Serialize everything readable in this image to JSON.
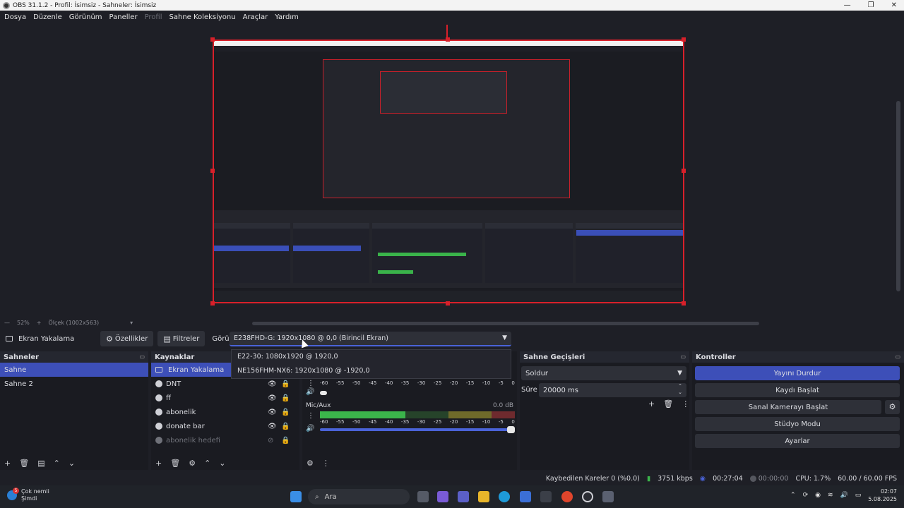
{
  "window": {
    "title": "OBS 31.1.2 - Profil: İsimsiz - Sahneler: İsimsiz"
  },
  "menu": [
    "Dosya",
    "Düzenle",
    "Görünüm",
    "Paneller",
    "Profil",
    "Sahne Koleksiyonu",
    "Araçlar",
    "Yardım"
  ],
  "preview_status": {
    "zoom": "52%",
    "scale": "Ölçek (1002x563)"
  },
  "source_toolbar": {
    "source_name": "Ekran Yakalama",
    "properties": "Özellikler",
    "filters": "Filtreler",
    "display_label": "Görüntü",
    "display_value": "E238FHD-G: 1920x1080 @ 0,0 (Birincil Ekran)",
    "display_options": [
      "E22-30: 1080x1920 @ 1920,0",
      "NE156FHM-NX6: 1920x1080 @ -1920,0"
    ]
  },
  "scenes": {
    "title": "Sahneler",
    "items": [
      "Sahne",
      "Sahne 2"
    ]
  },
  "sources": {
    "title": "Kaynaklar",
    "items": [
      "Ekran Yakalama",
      "DNT",
      "ff",
      "abonelik",
      "donate bar",
      "abonelik hedefi"
    ]
  },
  "mixer": {
    "ticks": [
      "-60",
      "-55",
      "-50",
      "-45",
      "-40",
      "-35",
      "-30",
      "-25",
      "-20",
      "-15",
      "-10",
      "-5",
      "0"
    ],
    "channels": [
      {
        "name": "Mic/Aux",
        "db": "0.0 dB",
        "level": 0.44
      }
    ]
  },
  "transitions": {
    "title": "Sahne Geçişleri",
    "type": "Soldur",
    "duration_label": "Süre",
    "duration": "20000 ms"
  },
  "controls": {
    "title": "Kontroller",
    "buttons": [
      "Yayını Durdur",
      "Kaydı Başlat",
      "Sanal Kamerayı Başlat",
      "Stüdyo Modu",
      "Ayarlar"
    ]
  },
  "status": {
    "dropped": "Kaybedilen Kareler 0 (%0.0)",
    "bitrate": "3751 kbps",
    "stream_time": "00:27:04",
    "rec_time": "00:00:00",
    "cpu": "CPU: 1.7%",
    "fps": "60.00 / 60.00 FPS"
  },
  "taskbar": {
    "notif_title": "Çok nemli",
    "notif_sub": "Şimdi",
    "notif_count": "5",
    "search_placeholder": "Ara",
    "time": "02:07",
    "date": "5.08.2025"
  },
  "colors": {
    "accent": "#3d4fb8",
    "preview_border": "#d8202a",
    "meter_green": "#3bb54b"
  }
}
